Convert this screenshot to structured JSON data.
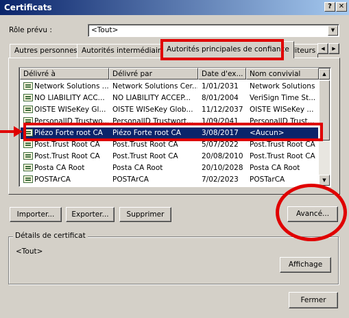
{
  "window": {
    "title": "Certificats",
    "help_button": "?",
    "close_button": "✕"
  },
  "role": {
    "label": "Rôle prévu :",
    "value": "<Tout>"
  },
  "tabs": [
    {
      "label": "Autres personnes"
    },
    {
      "label": "Autorités intermédiaires"
    },
    {
      "label": "Autorités principales de confiance"
    },
    {
      "label": "Éditeurs a"
    }
  ],
  "list": {
    "headers": [
      "Délivré à",
      "Délivré par",
      "Date d'ex...",
      "Nom convivial"
    ],
    "rows": [
      {
        "issued_to": "Network Solutions ...",
        "issued_by": "Network Solutions Cer...",
        "expires": "1/01/2031",
        "friendly": "Network Solutions"
      },
      {
        "issued_to": "NO LIABILITY ACC...",
        "issued_by": "NO LIABILITY ACCEP...",
        "expires": "8/01/2004",
        "friendly": "VeriSign Time St..."
      },
      {
        "issued_to": "OISTE WISeKey Gl...",
        "issued_by": "OISTE WISeKey Glob...",
        "expires": "11/12/2037",
        "friendly": "OISTE WISeKey ..."
      },
      {
        "issued_to": "PersonalID Trustwo...",
        "issued_by": "PersonalID Trustwort...",
        "expires": "1/09/2041",
        "friendly": "PersonalID Trust..."
      },
      {
        "issued_to": "Piézo Forte root CA",
        "issued_by": "Piézo Forte root CA",
        "expires": "3/08/2017",
        "friendly": "<Aucun>"
      },
      {
        "issued_to": "Post.Trust Root CA",
        "issued_by": "Post.Trust Root CA",
        "expires": "5/07/2022",
        "friendly": "Post.Trust Root CA"
      },
      {
        "issued_to": "Post.Trust Root CA",
        "issued_by": "Post.Trust Root CA",
        "expires": "20/08/2010",
        "friendly": "Post.Trust Root CA"
      },
      {
        "issued_to": "Posta CA Root",
        "issued_by": "Posta CA Root",
        "expires": "20/10/2028",
        "friendly": "Posta CA Root"
      },
      {
        "issued_to": "POSTArCA",
        "issued_by": "POSTArCA",
        "expires": "7/02/2023",
        "friendly": "POSTarCA"
      }
    ],
    "selected_index": 4
  },
  "buttons": {
    "import": "Importer...",
    "export": "Exporter...",
    "delete": "Supprimer",
    "advanced": "Avancé...",
    "view": "Affichage",
    "close": "Fermer"
  },
  "details": {
    "label": "Détails de certificat",
    "purposes": "<Tout>"
  },
  "colors": {
    "annotation": "#e00000",
    "selection": "#0a246a",
    "title_bar": "#0a246a"
  }
}
